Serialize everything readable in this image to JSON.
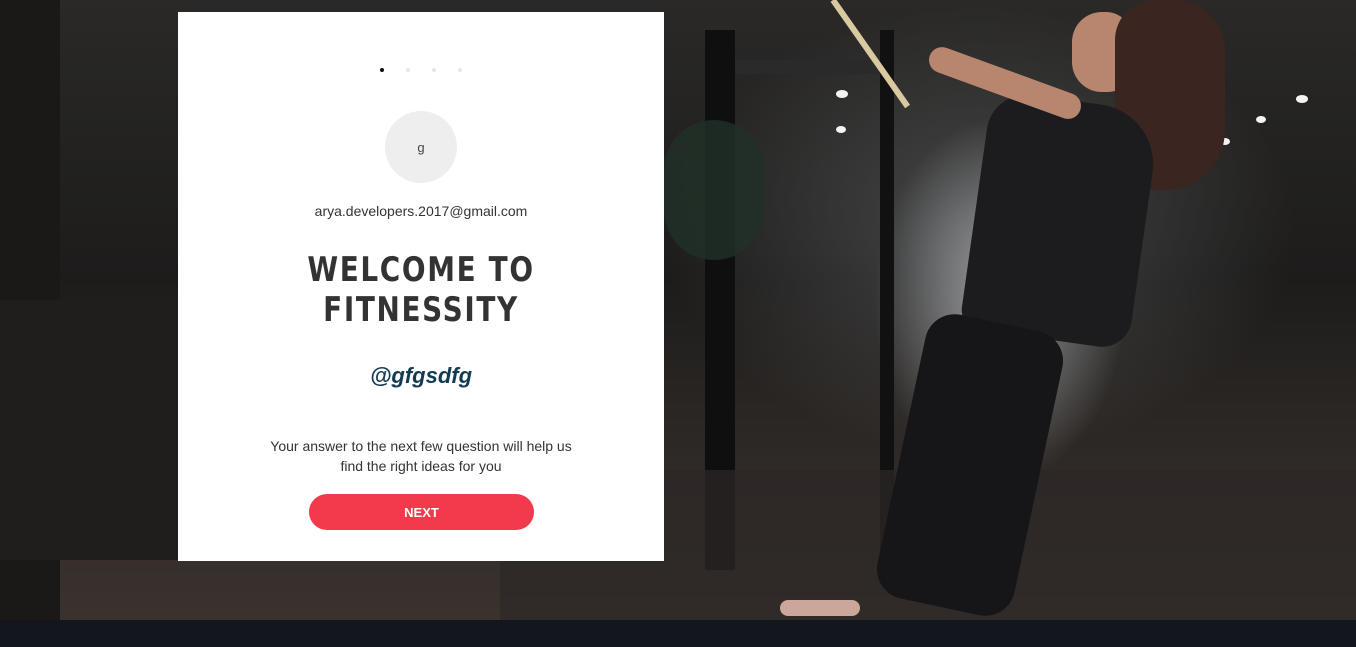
{
  "onboarding": {
    "steps": [
      {
        "state": "active"
      },
      {
        "state": "inactive"
      },
      {
        "state": "inactive"
      },
      {
        "state": "inactive"
      }
    ],
    "avatar_initial": "g",
    "email": "arya.developers.2017@gmail.com",
    "title_line1": "WELCOME TO",
    "title_line2": "FITNESSITY",
    "username": "@gfgsdfg",
    "description": "Your answer to the next few question will help us find the right ideas for you",
    "next_label": "NEXT"
  },
  "colors": {
    "accent": "#f23a4c",
    "username": "#143a52",
    "footer": "#14161e",
    "card": "#ffffff"
  }
}
